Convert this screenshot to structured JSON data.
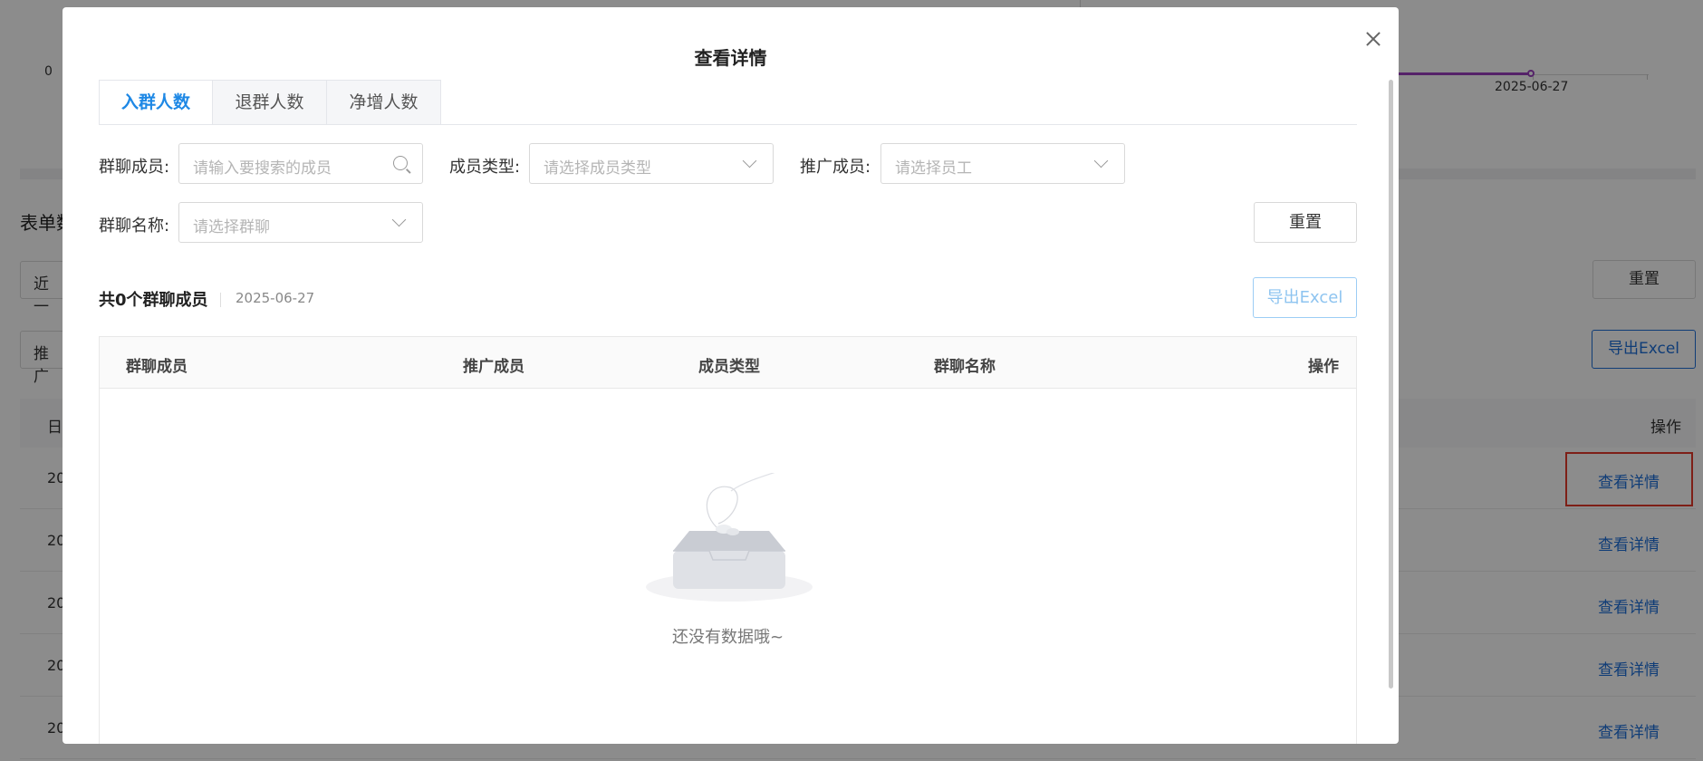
{
  "background": {
    "axis_zero": "0",
    "axis_date": "2025-06-27",
    "section_title": "表单数",
    "filter_select_1": "近一",
    "filter_select_2": "推广",
    "reset_label": "重置",
    "export_label": "导出Excel",
    "table": {
      "first_column_header": "日",
      "operation_header": "操作",
      "rows": [
        {
          "date": "20",
          "action": "查看详情"
        },
        {
          "date": "20",
          "action": "查看详情"
        },
        {
          "date": "20",
          "action": "查看详情"
        },
        {
          "date": "20",
          "action": "查看详情"
        },
        {
          "date": "20",
          "action": "查看详情"
        }
      ]
    },
    "colors": {
      "series": "#9b3fbf",
      "link": "#1e6fd9",
      "highlight": "#e5392b"
    }
  },
  "modal": {
    "title": "查看详情",
    "tabs": [
      {
        "label": "入群人数",
        "active": true
      },
      {
        "label": "退群人数",
        "active": false
      },
      {
        "label": "净增人数",
        "active": false
      }
    ],
    "filters": {
      "member": {
        "label": "群聊成员:",
        "placeholder": "请输入要搜索的成员"
      },
      "member_type": {
        "label": "成员类型:",
        "placeholder": "请选择成员类型"
      },
      "promoter": {
        "label": "推广成员:",
        "placeholder": "请选择员工"
      },
      "group_name": {
        "label": "群聊名称:",
        "placeholder": "请选择群聊"
      }
    },
    "reset_label": "重置",
    "summary": {
      "count_text": "共0个群聊成员",
      "date": "2025-06-27"
    },
    "export_label": "导出Excel",
    "table": {
      "columns": [
        "群聊成员",
        "推广成员",
        "成员类型",
        "群聊名称",
        "操作"
      ],
      "rows": [],
      "empty_text": "还没有数据哦~"
    },
    "colors": {
      "accent": "#1e88e5",
      "export_disabled": "#8ec4f0"
    }
  }
}
